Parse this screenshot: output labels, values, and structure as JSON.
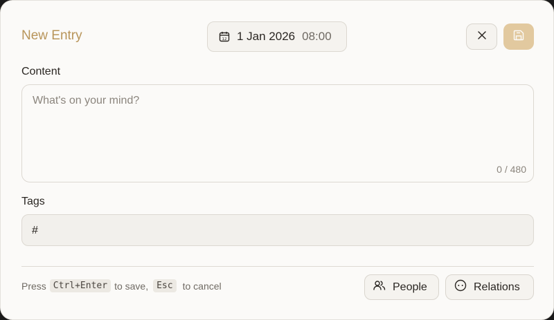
{
  "dialog": {
    "title": "New Entry",
    "date": "1 Jan 2026",
    "time": "08:00",
    "close_icon": "close-icon",
    "save_icon": "save-icon",
    "calendar_icon": "calendar-icon",
    "calendar_day": "12"
  },
  "content": {
    "label": "Content",
    "placeholder": "What's on your mind?",
    "value": "",
    "counter": "0 / 480"
  },
  "tags": {
    "label": "Tags",
    "prefix": "#",
    "value": ""
  },
  "footer": {
    "hint_press": "Press",
    "hint_key_save": "Ctrl+Enter",
    "hint_to_save": "to save,",
    "hint_key_cancel": "Esc",
    "hint_to_cancel": "to cancel",
    "people_label": "People",
    "relations_label": "Relations"
  },
  "colors": {
    "accent": "#b8955a",
    "save_button_bg": "#e2c99f",
    "background": "#fbfaf8"
  }
}
